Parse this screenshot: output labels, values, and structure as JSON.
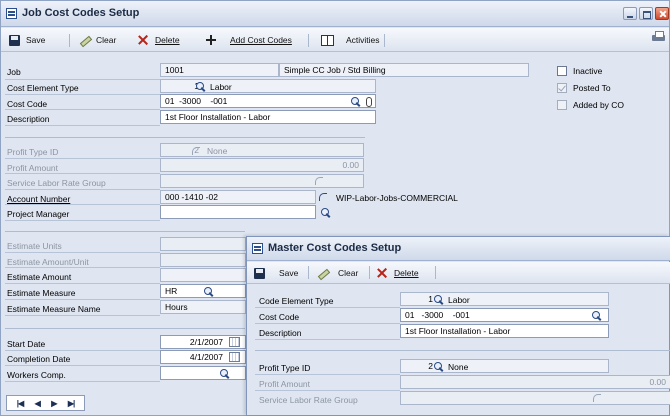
{
  "main": {
    "title": "Job Cost Codes Setup",
    "toolbar": {
      "save": "Save",
      "clear": "Clear",
      "delete": "Delete",
      "add_cost_codes": "Add Cost Codes",
      "activities": "Activities"
    },
    "fields": {
      "job_label": "Job",
      "job_value": "1001",
      "job_desc": "Simple CC Job / Std Billing",
      "cost_element_type_label": "Cost Element Type",
      "cost_element_type_num": "1",
      "cost_element_type_value": "Labor",
      "cost_code_label": "Cost Code",
      "cost_code_value": "01  -3000    -001",
      "description_label": "Description",
      "description_value": "1st Floor Installation - Labor",
      "profit_type_id_label": "Profit Type ID",
      "profit_type_id_num": "2",
      "profit_type_id_value": "None",
      "profit_amount_label": "Profit Amount",
      "profit_amount_value": "0.00",
      "service_labor_rate_group_label": "Service Labor Rate Group",
      "account_number_label": "Account Number",
      "account_number_value": "000 -1410 -02",
      "account_number_desc": "WIP-Labor-Jobs-COMMERCIAL",
      "project_manager_label": "Project Manager",
      "project_manager_value": "",
      "estimate_units_label": "Estimate Units",
      "estimate_amount_unit_label": "Estimate Amount/Unit",
      "estimate_amount_label": "Estimate Amount",
      "estimate_measure_label": "Estimate Measure",
      "estimate_measure_value": "HR",
      "estimate_measure_name_label": "Estimate Measure Name",
      "estimate_measure_name_value": "Hours",
      "start_date_label": "Start Date",
      "start_date_value": "2/1/2007",
      "completion_date_label": "Completion Date",
      "completion_date_value": "4/1/2007",
      "workers_comp_label": "Workers Comp."
    },
    "checkboxes": {
      "inactive": "Inactive",
      "posted_to": "Posted To",
      "added_by_co": "Added by CO"
    },
    "nav": [
      "|◀",
      "◀",
      "▶",
      "▶|"
    ]
  },
  "master": {
    "title": "Master Cost Codes Setup",
    "toolbar": {
      "save": "Save",
      "clear": "Clear",
      "delete": "Delete"
    },
    "fields": {
      "code_element_type_label": "Code Element Type",
      "code_element_type_num": "1",
      "code_element_type_value": "Labor",
      "cost_code_label": "Cost Code",
      "cost_code_value": "01   -3000    -001",
      "description_label": "Description",
      "description_value": "1st Floor Installation - Labor",
      "profit_type_id_label": "Profit Type ID",
      "profit_type_id_num": "2",
      "profit_type_id_value": "None",
      "profit_amount_label": "Profit Amount",
      "profit_amount_value": "0.00",
      "service_labor_rate_group_label": "Service Labor Rate Group"
    }
  }
}
